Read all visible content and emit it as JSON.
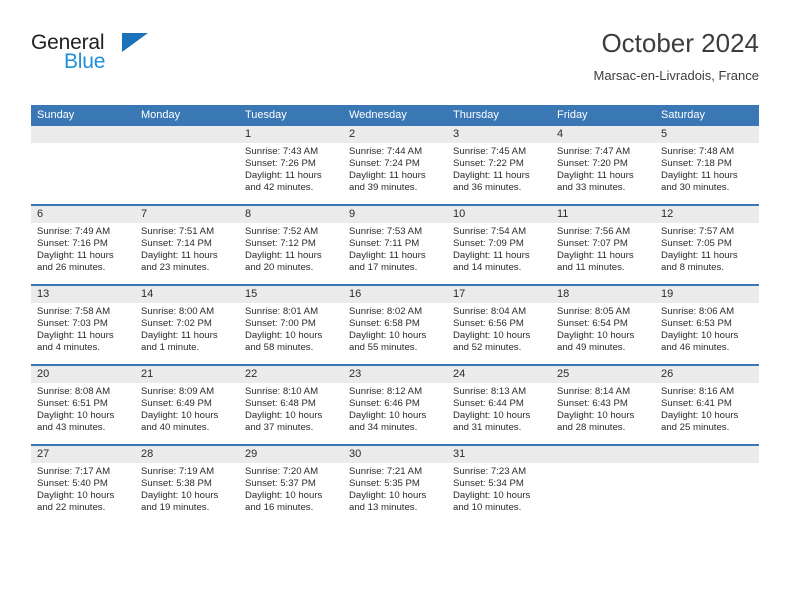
{
  "brand": {
    "name_dark": "General",
    "name_blue": "Blue",
    "accent_dark": "#231f20",
    "accent_blue": "#1f8fd8",
    "triangle_color": "#1b72b8"
  },
  "header": {
    "title": "October 2024",
    "subtitle": "Marsac-en-Livradois, France"
  },
  "colors": {
    "header_row_bg": "#3a77b5",
    "header_row_text": "#ffffff",
    "daynum_bg": "#ebebeb",
    "cell_bg": "#ffffff",
    "week_divider": "#3a77b5",
    "body_text": "#2b2b2b"
  },
  "weekday_headers": [
    "Sunday",
    "Monday",
    "Tuesday",
    "Wednesday",
    "Thursday",
    "Friday",
    "Saturday"
  ],
  "weeks": [
    [
      {
        "day": "",
        "sunrise": "",
        "sunset": "",
        "daylight_line1": "",
        "daylight_line2": ""
      },
      {
        "day": "",
        "sunrise": "",
        "sunset": "",
        "daylight_line1": "",
        "daylight_line2": ""
      },
      {
        "day": "1",
        "sunrise": "Sunrise: 7:43 AM",
        "sunset": "Sunset: 7:26 PM",
        "daylight_line1": "Daylight: 11 hours",
        "daylight_line2": "and 42 minutes."
      },
      {
        "day": "2",
        "sunrise": "Sunrise: 7:44 AM",
        "sunset": "Sunset: 7:24 PM",
        "daylight_line1": "Daylight: 11 hours",
        "daylight_line2": "and 39 minutes."
      },
      {
        "day": "3",
        "sunrise": "Sunrise: 7:45 AM",
        "sunset": "Sunset: 7:22 PM",
        "daylight_line1": "Daylight: 11 hours",
        "daylight_line2": "and 36 minutes."
      },
      {
        "day": "4",
        "sunrise": "Sunrise: 7:47 AM",
        "sunset": "Sunset: 7:20 PM",
        "daylight_line1": "Daylight: 11 hours",
        "daylight_line2": "and 33 minutes."
      },
      {
        "day": "5",
        "sunrise": "Sunrise: 7:48 AM",
        "sunset": "Sunset: 7:18 PM",
        "daylight_line1": "Daylight: 11 hours",
        "daylight_line2": "and 30 minutes."
      }
    ],
    [
      {
        "day": "6",
        "sunrise": "Sunrise: 7:49 AM",
        "sunset": "Sunset: 7:16 PM",
        "daylight_line1": "Daylight: 11 hours",
        "daylight_line2": "and 26 minutes."
      },
      {
        "day": "7",
        "sunrise": "Sunrise: 7:51 AM",
        "sunset": "Sunset: 7:14 PM",
        "daylight_line1": "Daylight: 11 hours",
        "daylight_line2": "and 23 minutes."
      },
      {
        "day": "8",
        "sunrise": "Sunrise: 7:52 AM",
        "sunset": "Sunset: 7:12 PM",
        "daylight_line1": "Daylight: 11 hours",
        "daylight_line2": "and 20 minutes."
      },
      {
        "day": "9",
        "sunrise": "Sunrise: 7:53 AM",
        "sunset": "Sunset: 7:11 PM",
        "daylight_line1": "Daylight: 11 hours",
        "daylight_line2": "and 17 minutes."
      },
      {
        "day": "10",
        "sunrise": "Sunrise: 7:54 AM",
        "sunset": "Sunset: 7:09 PM",
        "daylight_line1": "Daylight: 11 hours",
        "daylight_line2": "and 14 minutes."
      },
      {
        "day": "11",
        "sunrise": "Sunrise: 7:56 AM",
        "sunset": "Sunset: 7:07 PM",
        "daylight_line1": "Daylight: 11 hours",
        "daylight_line2": "and 11 minutes."
      },
      {
        "day": "12",
        "sunrise": "Sunrise: 7:57 AM",
        "sunset": "Sunset: 7:05 PM",
        "daylight_line1": "Daylight: 11 hours",
        "daylight_line2": "and 8 minutes."
      }
    ],
    [
      {
        "day": "13",
        "sunrise": "Sunrise: 7:58 AM",
        "sunset": "Sunset: 7:03 PM",
        "daylight_line1": "Daylight: 11 hours",
        "daylight_line2": "and 4 minutes."
      },
      {
        "day": "14",
        "sunrise": "Sunrise: 8:00 AM",
        "sunset": "Sunset: 7:02 PM",
        "daylight_line1": "Daylight: 11 hours",
        "daylight_line2": "and 1 minute."
      },
      {
        "day": "15",
        "sunrise": "Sunrise: 8:01 AM",
        "sunset": "Sunset: 7:00 PM",
        "daylight_line1": "Daylight: 10 hours",
        "daylight_line2": "and 58 minutes."
      },
      {
        "day": "16",
        "sunrise": "Sunrise: 8:02 AM",
        "sunset": "Sunset: 6:58 PM",
        "daylight_line1": "Daylight: 10 hours",
        "daylight_line2": "and 55 minutes."
      },
      {
        "day": "17",
        "sunrise": "Sunrise: 8:04 AM",
        "sunset": "Sunset: 6:56 PM",
        "daylight_line1": "Daylight: 10 hours",
        "daylight_line2": "and 52 minutes."
      },
      {
        "day": "18",
        "sunrise": "Sunrise: 8:05 AM",
        "sunset": "Sunset: 6:54 PM",
        "daylight_line1": "Daylight: 10 hours",
        "daylight_line2": "and 49 minutes."
      },
      {
        "day": "19",
        "sunrise": "Sunrise: 8:06 AM",
        "sunset": "Sunset: 6:53 PM",
        "daylight_line1": "Daylight: 10 hours",
        "daylight_line2": "and 46 minutes."
      }
    ],
    [
      {
        "day": "20",
        "sunrise": "Sunrise: 8:08 AM",
        "sunset": "Sunset: 6:51 PM",
        "daylight_line1": "Daylight: 10 hours",
        "daylight_line2": "and 43 minutes."
      },
      {
        "day": "21",
        "sunrise": "Sunrise: 8:09 AM",
        "sunset": "Sunset: 6:49 PM",
        "daylight_line1": "Daylight: 10 hours",
        "daylight_line2": "and 40 minutes."
      },
      {
        "day": "22",
        "sunrise": "Sunrise: 8:10 AM",
        "sunset": "Sunset: 6:48 PM",
        "daylight_line1": "Daylight: 10 hours",
        "daylight_line2": "and 37 minutes."
      },
      {
        "day": "23",
        "sunrise": "Sunrise: 8:12 AM",
        "sunset": "Sunset: 6:46 PM",
        "daylight_line1": "Daylight: 10 hours",
        "daylight_line2": "and 34 minutes."
      },
      {
        "day": "24",
        "sunrise": "Sunrise: 8:13 AM",
        "sunset": "Sunset: 6:44 PM",
        "daylight_line1": "Daylight: 10 hours",
        "daylight_line2": "and 31 minutes."
      },
      {
        "day": "25",
        "sunrise": "Sunrise: 8:14 AM",
        "sunset": "Sunset: 6:43 PM",
        "daylight_line1": "Daylight: 10 hours",
        "daylight_line2": "and 28 minutes."
      },
      {
        "day": "26",
        "sunrise": "Sunrise: 8:16 AM",
        "sunset": "Sunset: 6:41 PM",
        "daylight_line1": "Daylight: 10 hours",
        "daylight_line2": "and 25 minutes."
      }
    ],
    [
      {
        "day": "27",
        "sunrise": "Sunrise: 7:17 AM",
        "sunset": "Sunset: 5:40 PM",
        "daylight_line1": "Daylight: 10 hours",
        "daylight_line2": "and 22 minutes."
      },
      {
        "day": "28",
        "sunrise": "Sunrise: 7:19 AM",
        "sunset": "Sunset: 5:38 PM",
        "daylight_line1": "Daylight: 10 hours",
        "daylight_line2": "and 19 minutes."
      },
      {
        "day": "29",
        "sunrise": "Sunrise: 7:20 AM",
        "sunset": "Sunset: 5:37 PM",
        "daylight_line1": "Daylight: 10 hours",
        "daylight_line2": "and 16 minutes."
      },
      {
        "day": "30",
        "sunrise": "Sunrise: 7:21 AM",
        "sunset": "Sunset: 5:35 PM",
        "daylight_line1": "Daylight: 10 hours",
        "daylight_line2": "and 13 minutes."
      },
      {
        "day": "31",
        "sunrise": "Sunrise: 7:23 AM",
        "sunset": "Sunset: 5:34 PM",
        "daylight_line1": "Daylight: 10 hours",
        "daylight_line2": "and 10 minutes."
      },
      {
        "day": "",
        "sunrise": "",
        "sunset": "",
        "daylight_line1": "",
        "daylight_line2": ""
      },
      {
        "day": "",
        "sunrise": "",
        "sunset": "",
        "daylight_line1": "",
        "daylight_line2": ""
      }
    ]
  ]
}
